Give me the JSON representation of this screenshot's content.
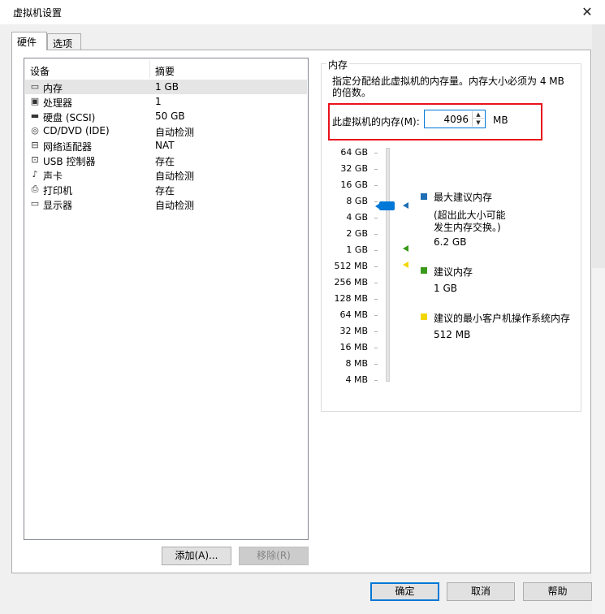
{
  "window": {
    "title": "虚拟机设置",
    "close_glyph": "✕"
  },
  "tabs": [
    {
      "label": "硬件",
      "active": true
    },
    {
      "label": "选项",
      "active": false
    }
  ],
  "device_table": {
    "col_device": "设备",
    "col_summary": "摘要",
    "rows": [
      {
        "icon": "memory-icon",
        "glyph": "▭",
        "name": "内存",
        "summary": "1 GB",
        "selected": true
      },
      {
        "icon": "processor-icon",
        "glyph": "▣",
        "name": "处理器",
        "summary": "1",
        "selected": false
      },
      {
        "icon": "hard-disk-icon",
        "glyph": "▬",
        "name": "硬盘 (SCSI)",
        "summary": "50 GB",
        "selected": false
      },
      {
        "icon": "cd-dvd-icon",
        "glyph": "◎",
        "name": "CD/DVD (IDE)",
        "summary": "自动检测",
        "selected": false
      },
      {
        "icon": "network-adapter-icon",
        "glyph": "⊟",
        "name": "网络适配器",
        "summary": "NAT",
        "selected": false
      },
      {
        "icon": "usb-controller-icon",
        "glyph": "⊡",
        "name": "USB 控制器",
        "summary": "存在",
        "selected": false
      },
      {
        "icon": "sound-card-icon",
        "glyph": "♪",
        "name": "声卡",
        "summary": "自动检测",
        "selected": false
      },
      {
        "icon": "printer-icon",
        "glyph": "⎙",
        "name": "打印机",
        "summary": "存在",
        "selected": false
      },
      {
        "icon": "display-icon",
        "glyph": "▭",
        "name": "显示器",
        "summary": "自动检测",
        "selected": false
      }
    ]
  },
  "buttons": {
    "add": "添加(A)...",
    "remove": "移除(R)",
    "ok": "确定",
    "cancel": "取消",
    "help": "帮助"
  },
  "memory": {
    "group_title": "内存",
    "description": "指定分配给此虚拟机的内存量。内存大小必须为 4 MB 的倍数。",
    "field_label": "此虚拟机的内存(M):",
    "value": "4096",
    "unit": "MB",
    "scale_ticks": [
      "64 GB",
      "32 GB",
      "16 GB",
      "8 GB",
      "4 GB",
      "2 GB",
      "1 GB",
      "512 MB",
      "256 MB",
      "128 MB",
      "64 MB",
      "32 MB",
      "16 MB",
      "8 MB",
      "4 MB"
    ],
    "legend": {
      "max": {
        "title": "最大建议内存",
        "note": "(超出此大小可能发生内存交换。)",
        "value": "6.2 GB",
        "color": "#1f6fb5"
      },
      "recommended": {
        "title": "建议内存",
        "value": "1 GB",
        "color": "#3a9a1a"
      },
      "min_guest": {
        "title": "建议的最小客户机操作系统内存",
        "value": "512 MB",
        "color": "#f2d600"
      }
    },
    "slider_color": "#0078d7"
  }
}
